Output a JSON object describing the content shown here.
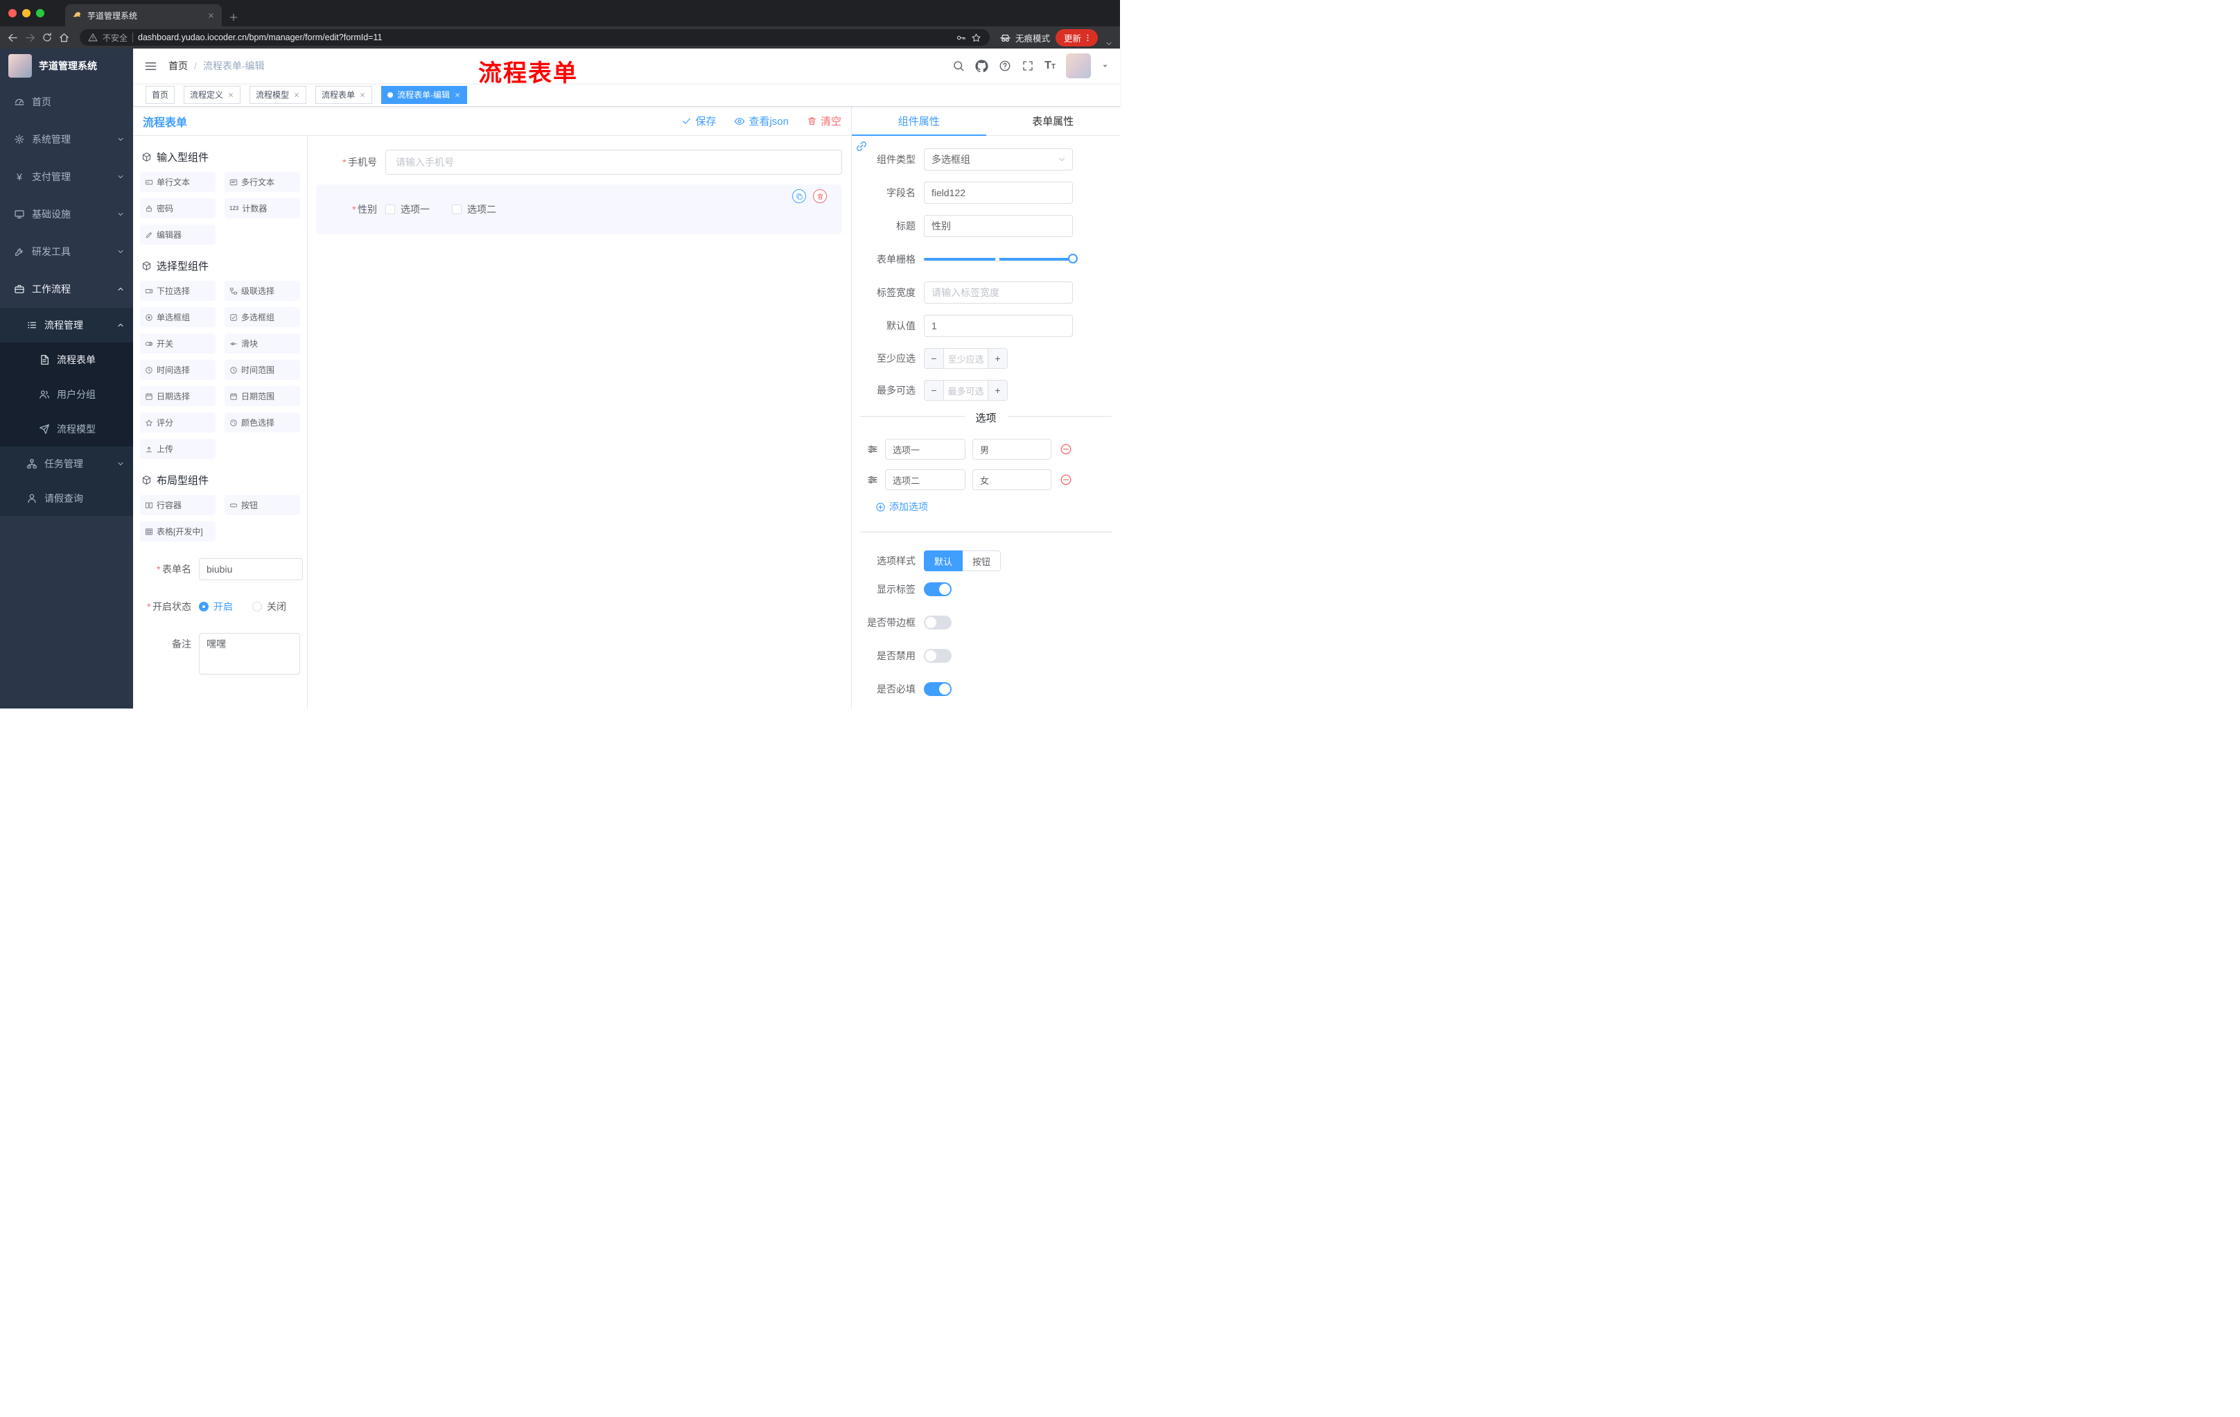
{
  "colors": {
    "primary": "#409eff",
    "danger": "#f56c6c",
    "annotation": "#ff0000"
  },
  "browser": {
    "tab": {
      "title": "芋道管理系统"
    },
    "toolbar": {
      "security_label": "不安全",
      "url": "dashboard.yudao.iocoder.cn/bpm/manager/form/edit?formId=11",
      "incognito_label": "无痕模式",
      "update_label": "更新"
    }
  },
  "sidebar": {
    "logo_title": "芋道管理系统",
    "menu": [
      {
        "label": "首页"
      },
      {
        "label": "系统管理"
      },
      {
        "label": "支付管理"
      },
      {
        "label": "基础设施"
      },
      {
        "label": "研发工具"
      },
      {
        "label": "工作流程"
      }
    ],
    "workflow": {
      "process_mgmt": {
        "label": "流程管理"
      },
      "process_children": [
        {
          "label": "流程表单"
        },
        {
          "label": "用户分组"
        },
        {
          "label": "流程模型"
        }
      ],
      "task_mgmt": {
        "label": "任务管理"
      },
      "leave_query": {
        "label": "请假查询"
      }
    }
  },
  "navbar": {
    "breadcrumb": {
      "home": "首页",
      "current": "流程表单-编辑"
    },
    "annotation": "流程表单"
  },
  "tags": [
    {
      "label": "首页"
    },
    {
      "label": "流程定义"
    },
    {
      "label": "流程模型"
    },
    {
      "label": "流程表单"
    },
    {
      "label": "流程表单-编辑"
    }
  ],
  "designer": {
    "title": "流程表单",
    "actions": {
      "save": "保存",
      "view_json": "查看json",
      "clear": "清空"
    }
  },
  "palette": {
    "sections": [
      {
        "title": "输入型组件",
        "items": [
          "单行文本",
          "多行文本",
          "密码",
          "计数器",
          "编辑器"
        ]
      },
      {
        "title": "选择型组件",
        "items": [
          "下拉选择",
          "级联选择",
          "单选框组",
          "多选框组",
          "开关",
          "滑块",
          "时间选择",
          "时间范围",
          "日期选择",
          "日期范围",
          "评分",
          "颜色选择",
          "上传"
        ]
      },
      {
        "title": "布局型组件",
        "items": [
          "行容器",
          "按钮",
          "表格[开发中]"
        ]
      }
    ],
    "meta": {
      "form_name_label": "表单名",
      "form_name_value": "biubiu",
      "status_label": "开启状态",
      "status_on": "开启",
      "status_off": "关闭",
      "remark_label": "备注",
      "remark_value": "嘿嘿"
    }
  },
  "canvas": {
    "phone": {
      "label": "手机号",
      "placeholder": "请输入手机号"
    },
    "gender": {
      "label": "性别",
      "option1": "选项一",
      "option2": "选项二"
    }
  },
  "props": {
    "tab_component": "组件属性",
    "tab_form": "表单属性",
    "component_type": {
      "label": "组件类型",
      "value": "多选框组"
    },
    "field_name": {
      "label": "字段名",
      "value": "field122"
    },
    "title": {
      "label": "标题",
      "value": "性别"
    },
    "grid": {
      "label": "表单栅格"
    },
    "label_width": {
      "label": "标签宽度",
      "placeholder": "请输入标签宽度"
    },
    "default_value": {
      "label": "默认值",
      "value": "1"
    },
    "min_select": {
      "label": "至少应选",
      "placeholder": "至少应选"
    },
    "max_select": {
      "label": "最多可选",
      "placeholder": "最多可选"
    },
    "options_title": "选项",
    "options": [
      {
        "name": "选项一",
        "value": "男"
      },
      {
        "name": "选项二",
        "value": "女"
      }
    ],
    "add_option": "添加选项",
    "option_style": {
      "label": "选项样式",
      "default": "默认",
      "button": "按钮"
    },
    "switches": {
      "show_label": "显示标签",
      "with_border": "是否带边框",
      "disabled": "是否禁用",
      "required": "是否必填"
    }
  }
}
